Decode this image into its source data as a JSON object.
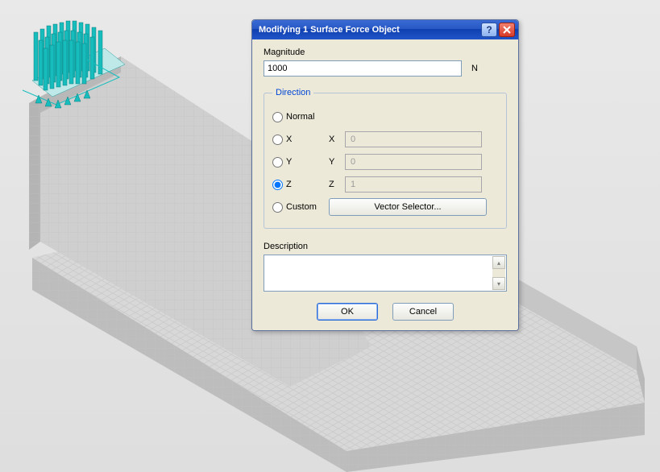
{
  "dialog": {
    "title": "Modifying 1 Surface Force Object",
    "magnitude_label": "Magnitude",
    "magnitude_value": "1000",
    "magnitude_unit": "N",
    "direction": {
      "legend": "Direction",
      "options": {
        "normal": "Normal",
        "x": "X",
        "y": "Y",
        "z": "Z",
        "custom": "Custom"
      },
      "selected": "z",
      "axis_labels": {
        "x": "X",
        "y": "Y",
        "z": "Z"
      },
      "values": {
        "x": "0",
        "y": "0",
        "z": "1"
      },
      "vector_selector_label": "Vector Selector..."
    },
    "description_label": "Description",
    "description_value": "",
    "buttons": {
      "ok": "OK",
      "cancel": "Cancel"
    }
  },
  "scene": {
    "description": "3D gray wireframe mesh structure (wedge/ramp on rectangular basin) with cyan surface-force arrows cluster on upper-left pad",
    "force_color": "#17bdbd",
    "mesh_color": "#b7b7b7"
  }
}
